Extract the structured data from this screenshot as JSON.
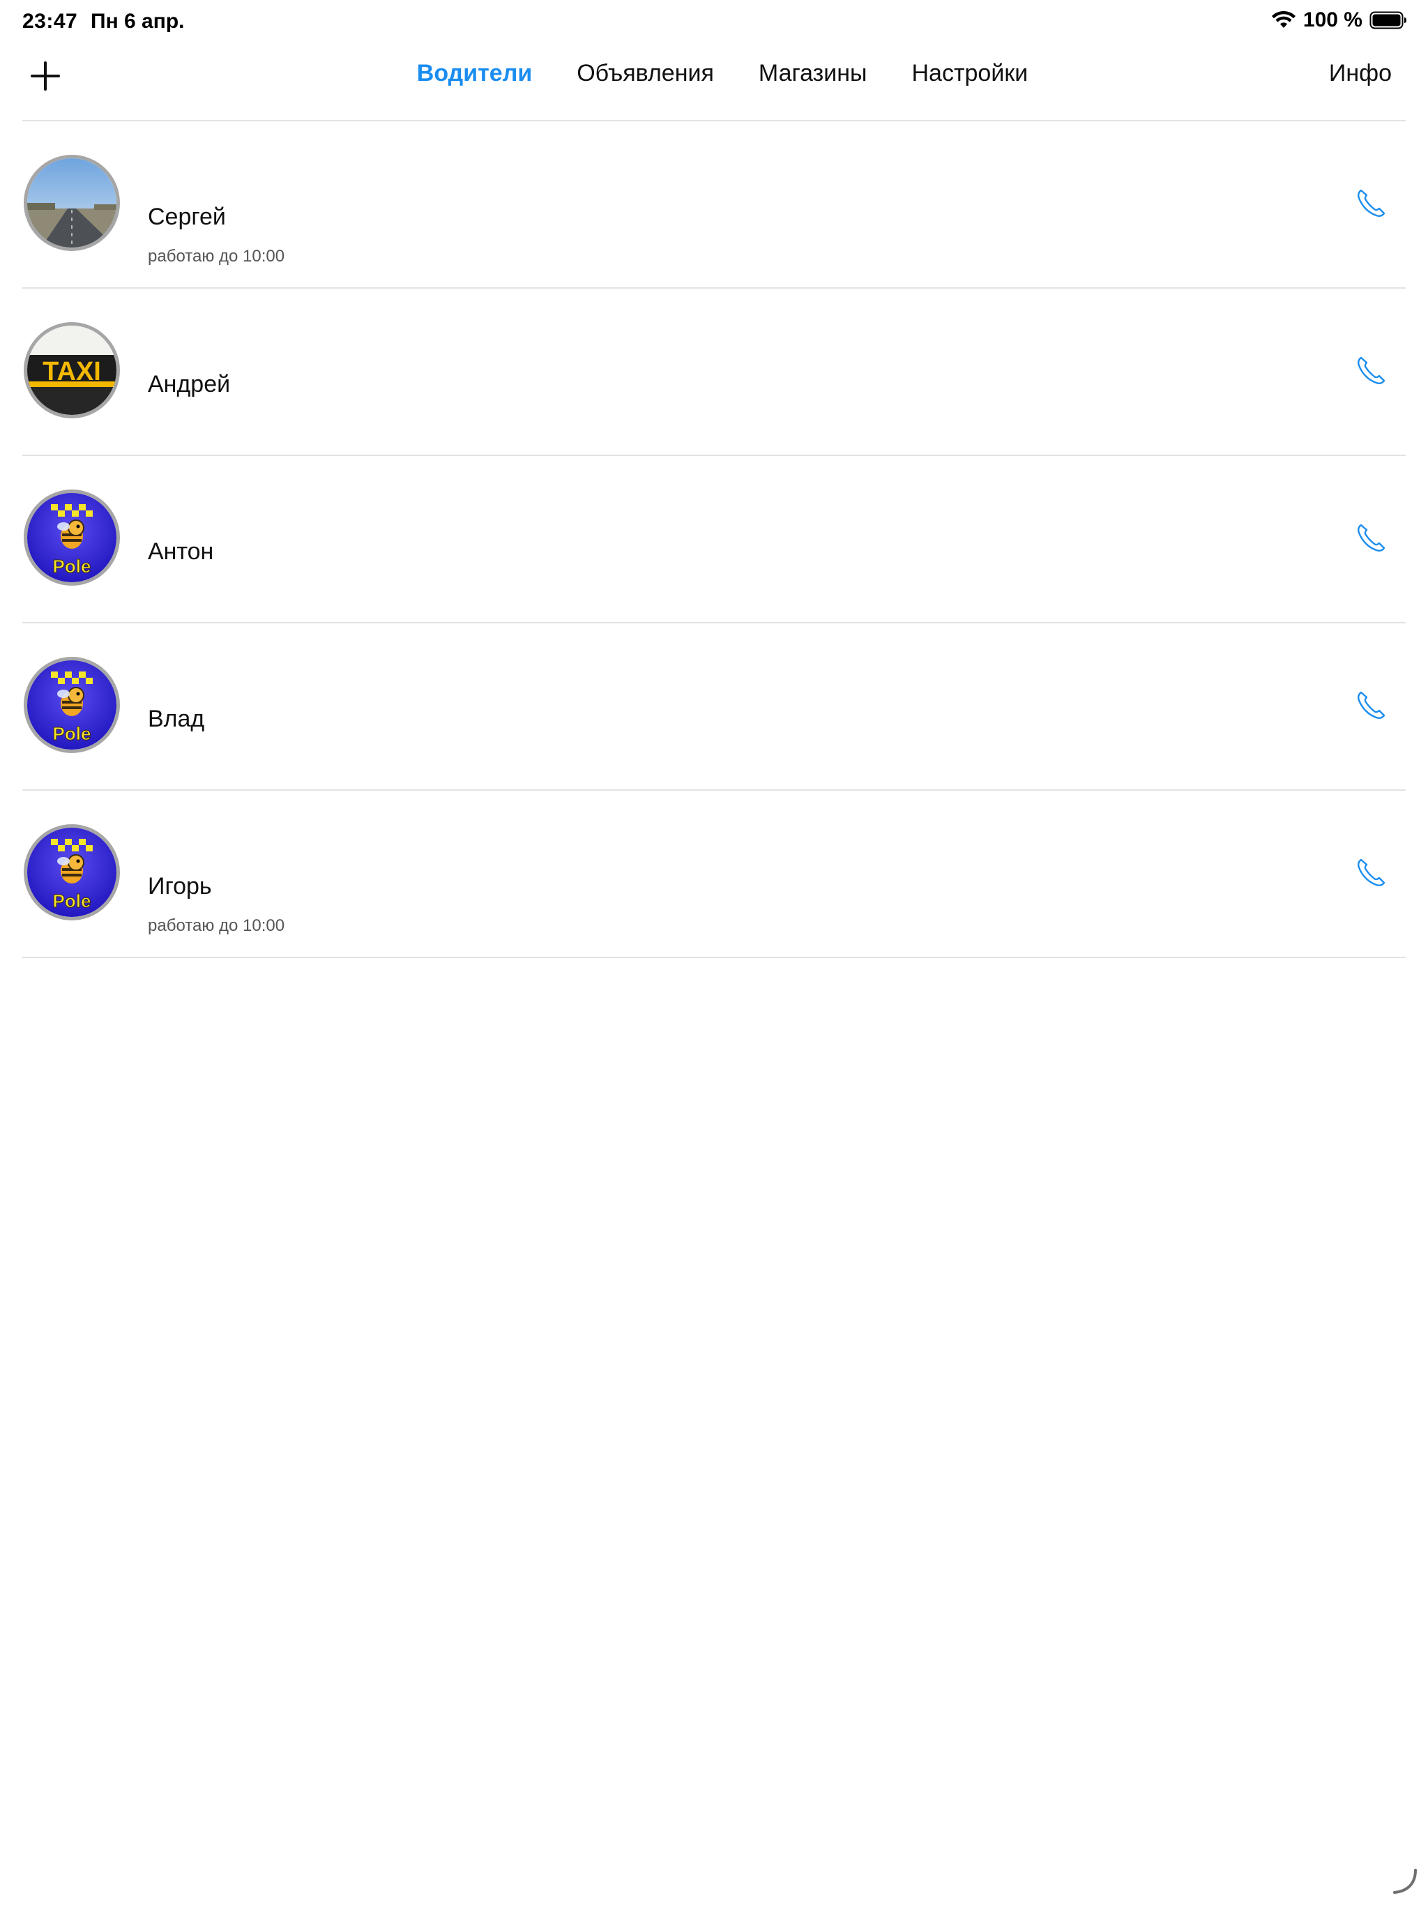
{
  "status_bar": {
    "time": "23:47",
    "date": "Пн 6 апр.",
    "battery_text": "100 %",
    "wifi_icon": "wifi-icon",
    "battery_icon": "battery-full-icon"
  },
  "navbar": {
    "add_icon": "plus-icon",
    "tabs": [
      {
        "label": "Водители",
        "active": true
      },
      {
        "label": "Объявления",
        "active": false
      },
      {
        "label": "Магазины",
        "active": false
      },
      {
        "label": "Настройки",
        "active": false
      }
    ],
    "info_label": "Инфо",
    "accent_color": "#1a8df0"
  },
  "drivers": [
    {
      "name": "Сергей",
      "status": "работаю до 10:00",
      "avatar": "road-photo-avatar",
      "call_icon": "phone-icon"
    },
    {
      "name": "Андрей",
      "status": "",
      "avatar": "taxi-sign-avatar",
      "call_icon": "phone-icon"
    },
    {
      "name": "Антон",
      "status": "",
      "avatar": "bee-taxi-logo-avatar",
      "call_icon": "phone-icon"
    },
    {
      "name": "Влад",
      "status": "",
      "avatar": "bee-taxi-logo-avatar",
      "call_icon": "phone-icon"
    },
    {
      "name": "Игорь",
      "status": "работаю до 10:00",
      "avatar": "bee-taxi-logo-avatar",
      "call_icon": "phone-icon"
    }
  ]
}
